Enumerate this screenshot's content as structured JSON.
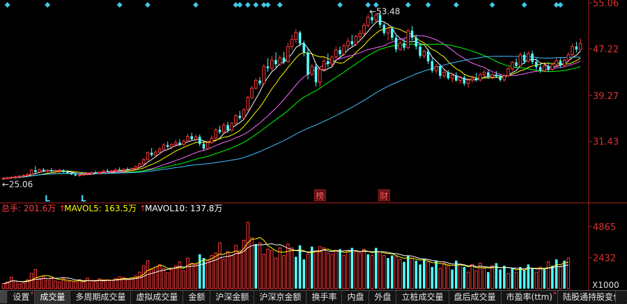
{
  "chart_data": [
    {
      "type": "candlestick",
      "panel": "price",
      "y_ticks": [
        "55.06",
        "47.22",
        "39.27",
        "31.43"
      ],
      "ylim": [
        22.0,
        55.06
      ],
      "high_label": "53.48",
      "low_label": "25.06",
      "markers": [
        {
          "text": "L",
          "index": 11
        },
        {
          "text": "L",
          "index": 20
        },
        {
          "text": "榜",
          "index": 79
        },
        {
          "text": "财",
          "index": 95
        }
      ],
      "ma_colors": [
        "#ffffff",
        "#ffff00",
        "#ff66ff",
        "#00ff00",
        "#40c0ff"
      ],
      "top_diamond_indices": [
        1,
        11,
        29,
        36,
        48,
        58,
        59,
        61,
        63,
        65,
        66,
        69,
        84,
        91,
        93,
        101,
        106,
        113,
        122,
        130,
        138,
        139
      ],
      "ohlc": [
        [
          25.0,
          25.3,
          24.8,
          25.1
        ],
        [
          25.1,
          25.4,
          24.9,
          25.2
        ],
        [
          25.2,
          25.5,
          25.0,
          25.3
        ],
        [
          25.3,
          25.6,
          25.0,
          25.4
        ],
        [
          25.4,
          25.7,
          25.1,
          25.5
        ],
        [
          25.5,
          25.8,
          25.2,
          25.6
        ],
        [
          25.6,
          26.0,
          25.3,
          25.8
        ],
        [
          25.8,
          26.7,
          25.6,
          26.5
        ],
        [
          26.5,
          27.2,
          26.0,
          26.2
        ],
        [
          26.2,
          26.8,
          25.9,
          26.6
        ],
        [
          26.6,
          26.9,
          26.2,
          26.4
        ],
        [
          26.4,
          26.7,
          26.1,
          26.5
        ],
        [
          26.5,
          26.9,
          26.2,
          26.3
        ],
        [
          26.3,
          26.6,
          26.0,
          26.4
        ],
        [
          26.4,
          26.8,
          26.1,
          26.5
        ],
        [
          26.5,
          26.7,
          26.1,
          26.2
        ],
        [
          26.2,
          26.5,
          25.9,
          26.0
        ],
        [
          26.0,
          26.3,
          25.7,
          25.8
        ],
        [
          25.8,
          26.1,
          25.5,
          25.6
        ],
        [
          25.6,
          25.9,
          25.4,
          25.7
        ],
        [
          25.7,
          26.0,
          25.5,
          25.8
        ],
        [
          25.8,
          26.1,
          25.6,
          25.9
        ],
        [
          25.9,
          26.3,
          25.7,
          26.1
        ],
        [
          26.1,
          26.4,
          25.9,
          26.0
        ],
        [
          26.0,
          26.3,
          25.8,
          26.2
        ],
        [
          26.2,
          26.6,
          26.0,
          26.4
        ],
        [
          26.4,
          26.7,
          26.2,
          26.3
        ],
        [
          26.3,
          26.6,
          26.1,
          26.4
        ],
        [
          26.4,
          26.8,
          26.2,
          26.6
        ],
        [
          26.6,
          27.0,
          26.4,
          26.5
        ],
        [
          26.5,
          26.8,
          26.3,
          26.7
        ],
        [
          26.7,
          27.0,
          26.5,
          26.6
        ],
        [
          26.6,
          27.0,
          26.4,
          26.8
        ],
        [
          26.8,
          27.3,
          26.6,
          27.1
        ],
        [
          27.1,
          27.8,
          26.9,
          27.6
        ],
        [
          27.6,
          28.6,
          27.4,
          28.3
        ],
        [
          28.3,
          29.7,
          28.1,
          29.5
        ],
        [
          29.5,
          30.3,
          28.8,
          29.1
        ],
        [
          29.1,
          29.9,
          28.7,
          29.6
        ],
        [
          29.6,
          30.4,
          29.2,
          30.1
        ],
        [
          30.1,
          31.1,
          29.7,
          30.8
        ],
        [
          30.8,
          31.4,
          30.2,
          30.5
        ],
        [
          30.5,
          31.1,
          30.1,
          30.9
        ],
        [
          30.9,
          31.7,
          30.5,
          31.2
        ],
        [
          31.2,
          31.8,
          30.6,
          30.9
        ],
        [
          30.9,
          31.7,
          30.6,
          31.5
        ],
        [
          31.5,
          32.7,
          31.2,
          32.3
        ],
        [
          32.3,
          32.9,
          31.5,
          31.8
        ],
        [
          31.8,
          32.6,
          31.3,
          32.2
        ],
        [
          32.2,
          32.6,
          30.6,
          31.0
        ],
        [
          31.0,
          31.5,
          29.8,
          30.2
        ],
        [
          30.2,
          31.6,
          29.9,
          31.2
        ],
        [
          31.2,
          32.4,
          31.0,
          32.0
        ],
        [
          32.0,
          33.7,
          31.8,
          33.4
        ],
        [
          33.4,
          34.1,
          32.7,
          33.0
        ],
        [
          33.0,
          34.6,
          32.8,
          34.2
        ],
        [
          34.2,
          34.8,
          32.9,
          33.3
        ],
        [
          33.3,
          34.7,
          33.1,
          34.5
        ],
        [
          34.5,
          36.1,
          34.3,
          35.8
        ],
        [
          35.8,
          36.6,
          35.1,
          35.4
        ],
        [
          35.4,
          37.1,
          35.2,
          36.8
        ],
        [
          36.8,
          39.2,
          36.6,
          38.9
        ],
        [
          38.9,
          40.9,
          38.6,
          40.5
        ],
        [
          40.5,
          42.2,
          40.3,
          41.8
        ],
        [
          41.8,
          42.4,
          40.9,
          41.3
        ],
        [
          41.3,
          44.6,
          41.1,
          44.2
        ],
        [
          44.2,
          45.6,
          43.3,
          43.9
        ],
        [
          43.9,
          46.0,
          43.5,
          45.3
        ],
        [
          45.3,
          46.6,
          44.0,
          44.6
        ],
        [
          44.6,
          46.1,
          44.2,
          45.7
        ],
        [
          45.7,
          46.7,
          44.6,
          45.0
        ],
        [
          45.0,
          48.2,
          44.8,
          47.6
        ],
        [
          47.6,
          49.6,
          47.0,
          48.8
        ],
        [
          48.8,
          50.6,
          48.2,
          50.0
        ],
        [
          50.0,
          50.3,
          47.6,
          48.1
        ],
        [
          48.1,
          48.6,
          45.9,
          46.6
        ],
        [
          46.6,
          47.4,
          42.0,
          42.8
        ],
        [
          42.8,
          44.6,
          42.6,
          44.2
        ],
        [
          44.2,
          44.6,
          40.8,
          41.5
        ],
        [
          41.5,
          44.1,
          40.6,
          43.7
        ],
        [
          43.7,
          45.6,
          43.3,
          45.1
        ],
        [
          45.1,
          46.4,
          44.1,
          44.6
        ],
        [
          44.6,
          46.1,
          44.3,
          45.8
        ],
        [
          45.8,
          47.6,
          45.4,
          47.0
        ],
        [
          47.0,
          47.6,
          45.9,
          46.3
        ],
        [
          46.3,
          48.1,
          46.0,
          47.7
        ],
        [
          47.7,
          49.1,
          47.2,
          48.5
        ],
        [
          48.5,
          49.6,
          47.6,
          48.0
        ],
        [
          48.0,
          49.6,
          47.7,
          49.3
        ],
        [
          49.3,
          50.4,
          48.5,
          49.8
        ],
        [
          49.8,
          51.6,
          49.4,
          51.2
        ],
        [
          51.2,
          53.1,
          50.8,
          52.6
        ],
        [
          52.6,
          53.48,
          51.5,
          52.1
        ],
        [
          52.1,
          53.3,
          51.8,
          53.0
        ],
        [
          53.0,
          53.4,
          50.8,
          51.3
        ],
        [
          51.3,
          51.6,
          49.5,
          49.9
        ],
        [
          49.9,
          51.2,
          48.6,
          50.7
        ],
        [
          50.7,
          51.1,
          48.6,
          49.1
        ],
        [
          49.1,
          49.5,
          46.6,
          47.1
        ],
        [
          47.1,
          48.6,
          46.8,
          48.2
        ],
        [
          48.2,
          48.9,
          46.9,
          47.4
        ],
        [
          47.4,
          50.6,
          47.1,
          50.3
        ],
        [
          50.3,
          51.1,
          48.6,
          49.1
        ],
        [
          49.1,
          49.6,
          47.1,
          47.6
        ],
        [
          47.6,
          48.1,
          45.6,
          46.0
        ],
        [
          46.0,
          47.1,
          45.6,
          46.8
        ],
        [
          46.8,
          47.2,
          44.6,
          45.1
        ],
        [
          45.1,
          45.6,
          43.1,
          43.5
        ],
        [
          43.5,
          44.6,
          43.0,
          44.2
        ],
        [
          44.2,
          44.6,
          42.1,
          42.6
        ],
        [
          42.6,
          43.6,
          42.2,
          43.2
        ],
        [
          43.2,
          43.6,
          41.9,
          42.2
        ],
        [
          42.2,
          43.1,
          41.5,
          42.7
        ],
        [
          42.7,
          43.2,
          41.6,
          41.8
        ],
        [
          41.8,
          42.6,
          41.3,
          42.3
        ],
        [
          42.3,
          42.8,
          40.9,
          41.3
        ],
        [
          41.3,
          42.2,
          40.6,
          41.9
        ],
        [
          41.9,
          42.6,
          41.4,
          42.2
        ],
        [
          42.2,
          43.1,
          41.6,
          41.9
        ],
        [
          41.9,
          43.1,
          41.6,
          42.8
        ],
        [
          42.8,
          43.6,
          42.4,
          43.2
        ],
        [
          43.2,
          43.6,
          42.1,
          42.4
        ],
        [
          42.4,
          43.1,
          42.0,
          42.8
        ],
        [
          42.8,
          43.4,
          42.2,
          42.5
        ],
        [
          42.5,
          42.8,
          41.6,
          41.9
        ],
        [
          41.9,
          42.9,
          41.6,
          42.6
        ],
        [
          42.6,
          44.1,
          42.4,
          43.8
        ],
        [
          43.8,
          45.1,
          43.4,
          44.9
        ],
        [
          44.9,
          45.6,
          43.9,
          44.3
        ],
        [
          44.3,
          46.6,
          44.1,
          46.2
        ],
        [
          46.2,
          46.7,
          44.6,
          45.1
        ],
        [
          45.1,
          46.8,
          44.9,
          46.4
        ],
        [
          46.4,
          46.9,
          44.6,
          45.0
        ],
        [
          45.0,
          45.6,
          43.6,
          44.1
        ],
        [
          44.1,
          44.6,
          43.1,
          43.5
        ],
        [
          43.5,
          44.6,
          43.2,
          44.3
        ],
        [
          44.3,
          44.9,
          43.3,
          43.7
        ],
        [
          43.7,
          44.8,
          43.4,
          44.5
        ],
        [
          44.5,
          45.6,
          44.1,
          45.2
        ],
        [
          45.2,
          45.6,
          44.0,
          44.4
        ],
        [
          44.4,
          45.6,
          44.2,
          45.3
        ],
        [
          45.3,
          46.6,
          45.1,
          46.2
        ],
        [
          46.2,
          48.1,
          45.9,
          47.6
        ],
        [
          47.6,
          48.4,
          46.6,
          47.1
        ],
        [
          47.1,
          49.0,
          46.9,
          48.1
        ]
      ]
    },
    {
      "type": "bar",
      "panel": "volume",
      "y_ticks": [
        "4865",
        "2432"
      ],
      "ylim": [
        0,
        5800
      ],
      "unit_label": "X1000",
      "legend": [
        {
          "label": "总手: 201.6万",
          "color": "#ff4040"
        },
        {
          "label": "MAVOL5: 163.5万",
          "color": "#ffff00"
        },
        {
          "label": "MAVOL10: 137.8万",
          "color": "#ffffff"
        }
      ],
      "values": [
        400,
        520,
        900,
        600,
        380,
        450,
        700,
        1200,
        1500,
        800,
        950,
        700,
        850,
        600,
        520,
        780,
        550,
        600,
        480,
        700,
        520,
        820,
        640,
        550,
        780,
        600,
        700,
        660,
        800,
        920,
        880,
        700,
        850,
        990,
        1300,
        1800,
        2200,
        1500,
        1700,
        1900,
        1600,
        1250,
        1500,
        1800,
        2100,
        1400,
        2400,
        2000,
        1900,
        2700,
        2400,
        2200,
        2600,
        2800,
        3600,
        2300,
        2900,
        2600,
        3400,
        3000,
        3800,
        5200,
        4000,
        3500,
        3600,
        2700,
        3100,
        3000,
        2400,
        3200,
        2600,
        3500,
        3200,
        2500,
        3400,
        2300,
        2700,
        3300,
        2900,
        3300,
        3200,
        2800,
        2700,
        3000,
        3100,
        2600,
        3000,
        3200,
        2900,
        2800,
        3100,
        2700,
        2600,
        3200,
        2900,
        2600,
        2400,
        2600,
        2500,
        2300,
        2100,
        2600,
        2400,
        2200,
        1900,
        2300,
        2100,
        1700,
        2200,
        1600,
        2000,
        1800,
        1500,
        2200,
        1900,
        1700,
        1300,
        1900,
        1400,
        2000,
        1600,
        1300,
        1800,
        2000,
        1500,
        1800,
        1200,
        1600,
        1300,
        1700,
        1500,
        1900,
        1600,
        1300,
        1700,
        1500,
        2100,
        1800,
        2300,
        1700,
        2200,
        2400
      ],
      "down_indices": [
        49,
        50,
        63,
        73,
        74,
        75,
        77,
        84,
        87,
        91,
        93,
        96,
        97,
        100,
        101,
        103,
        104,
        105,
        107,
        108,
        112,
        113,
        115,
        121,
        123,
        124,
        125,
        127,
        129,
        130,
        131,
        132,
        135,
        137,
        138,
        140
      ]
    }
  ],
  "tabs": [
    {
      "label": "设置",
      "dot": "*"
    },
    {
      "label": "成交量",
      "dot": ""
    },
    {
      "label": "多周期成交量",
      "dot": ""
    },
    {
      "label": "虚拟成交量",
      "dot": ""
    },
    {
      "label": "金额",
      "dot": ""
    },
    {
      "label": "沪深金额",
      "dot": ""
    },
    {
      "label": "沪深京金额",
      "dot": ""
    },
    {
      "label": "换手率",
      "dot": ""
    },
    {
      "label": "内盘",
      "dot": ""
    },
    {
      "label": "外盘",
      "dot": ""
    },
    {
      "label": "立桩成交量",
      "dot": ""
    },
    {
      "label": "盘后成交量",
      "dot": ""
    },
    {
      "label": "市盈率(ttm)",
      "dot": "*"
    },
    {
      "label": "陆股通持股变化",
      "dot": ""
    }
  ]
}
